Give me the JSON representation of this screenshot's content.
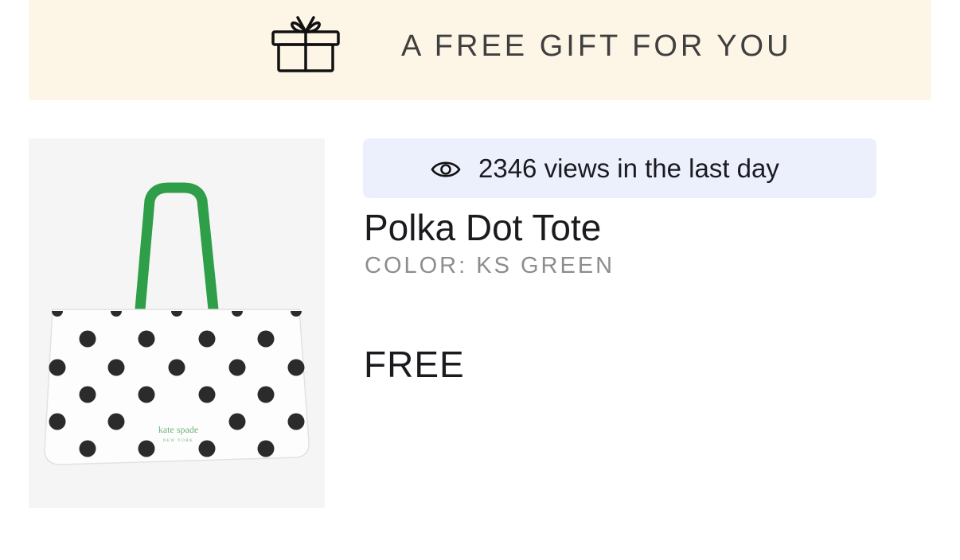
{
  "banner": {
    "icon": "gift-icon",
    "text": "A FREE GIFT FOR YOU",
    "background": "#fdf6e6"
  },
  "product": {
    "image_alt": "Polka Dot Tote",
    "image_brand_text": "kate spade",
    "image_brand_subtext": "NEW YORK",
    "views_icon": "eye-icon",
    "views_text": "2346 views in the last day",
    "views_badge_color": "#ecf0fd",
    "title": "Polka Dot Tote",
    "color_text": "COLOR: KS GREEN",
    "price": "FREE",
    "strap_color": "#2e9e48"
  }
}
